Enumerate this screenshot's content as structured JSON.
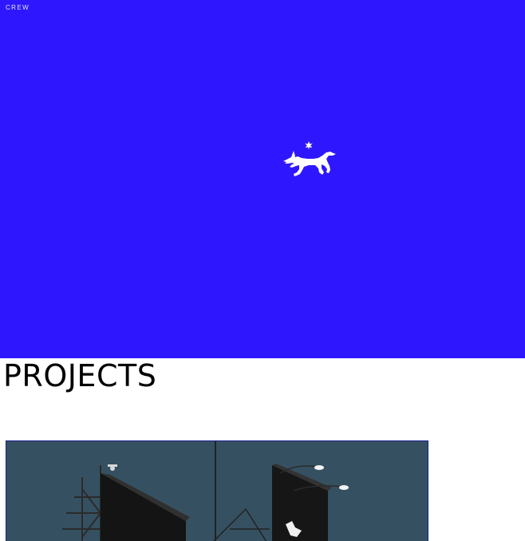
{
  "nav": {
    "crew_label": "CREW"
  },
  "hero": {
    "background_color": "#2e17ff",
    "logo_icon": "wolf-star-logo-icon"
  },
  "projects": {
    "heading": "PROJECTS",
    "items": [
      {
        "image_icon": "billboard-photo"
      }
    ]
  }
}
